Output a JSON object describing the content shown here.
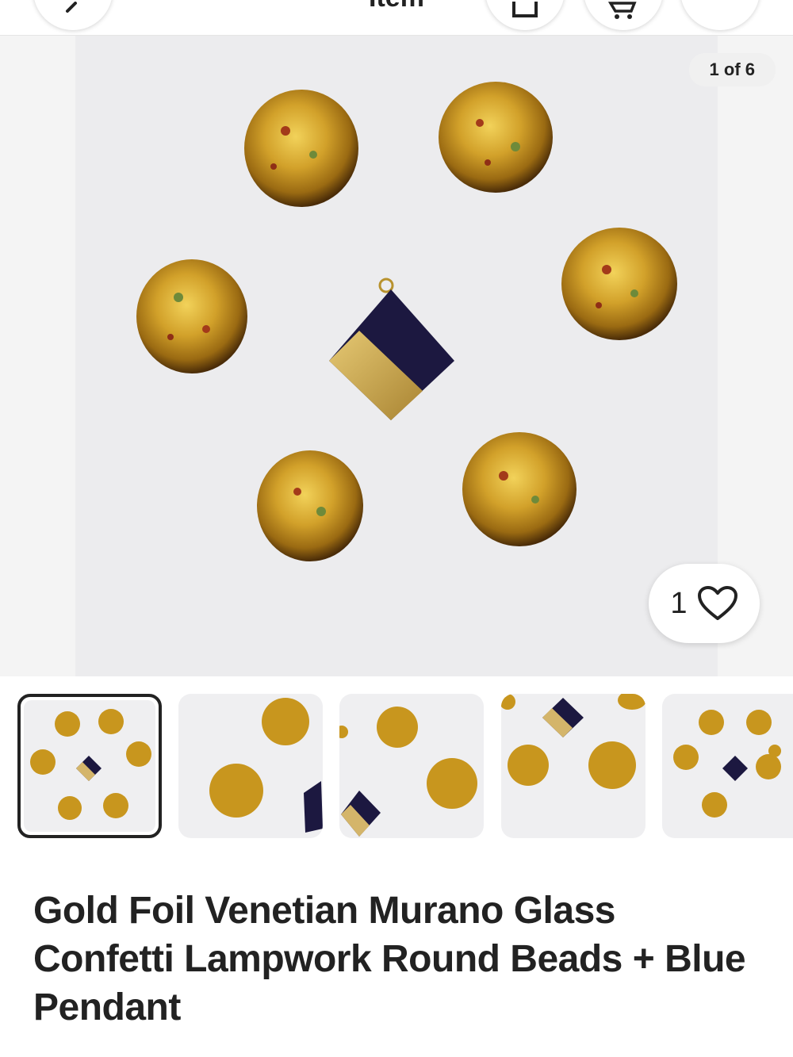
{
  "header": {
    "title": "Item",
    "back_icon": "chevron-left-icon",
    "share_icon": "share-icon",
    "cart_icon": "cart-icon"
  },
  "gallery": {
    "counter": "1 of 6",
    "favorites_count": "1",
    "thumbnails": [
      {
        "label": "Photo 1",
        "selected": true
      },
      {
        "label": "Photo 2",
        "selected": false
      },
      {
        "label": "Photo 3",
        "selected": false
      },
      {
        "label": "Photo 4",
        "selected": false
      },
      {
        "label": "Photo 5",
        "selected": false
      }
    ]
  },
  "listing": {
    "title": "Gold Foil Venetian Murano Glass Confetti Lampwork Round Beads + Blue Pendant"
  },
  "colors": {
    "gold": "#c8961e",
    "navy": "#1c1840",
    "text": "#222222"
  }
}
